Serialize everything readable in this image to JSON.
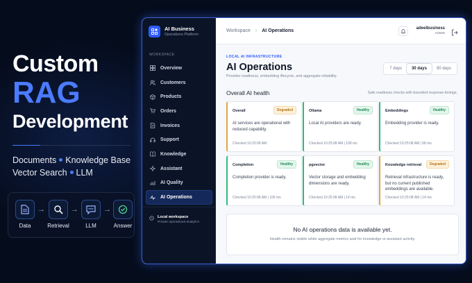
{
  "promo": {
    "line1": "Custom",
    "line2": "RAG",
    "line3": "Development",
    "tags_row1": [
      "Documents",
      "Knowledge Base"
    ],
    "tags_row2": [
      "Vector Search",
      "LLM"
    ],
    "flow": [
      {
        "label": "Data",
        "icon": "document-icon"
      },
      {
        "label": "Retrieval",
        "icon": "search-icon"
      },
      {
        "label": "LLM",
        "icon": "chat-icon"
      },
      {
        "label": "Answer",
        "icon": "check-circle-icon"
      }
    ],
    "accent": "#4b7bff"
  },
  "app": {
    "brand_name": "AI Business",
    "brand_sub": "Operations Platform",
    "workspace_label": "WORKSPACE",
    "nav": [
      {
        "label": "Overview",
        "icon": "grid-icon"
      },
      {
        "label": "Customers",
        "icon": "users-icon"
      },
      {
        "label": "Products",
        "icon": "box-icon"
      },
      {
        "label": "Orders",
        "icon": "cart-icon"
      },
      {
        "label": "Invoices",
        "icon": "invoice-icon"
      },
      {
        "label": "Support",
        "icon": "support-icon"
      },
      {
        "label": "Knowledge",
        "icon": "book-icon"
      },
      {
        "label": "Assistant",
        "icon": "sparkle-icon"
      },
      {
        "label": "AI Quality",
        "icon": "chart-icon"
      },
      {
        "label": "AI Operations",
        "icon": "pulse-icon",
        "active": true
      }
    ],
    "footer_title": "Local workspace",
    "footer_sub": "Private operational analytics"
  },
  "topbar": {
    "crumb_root": "Workspace",
    "crumb_sep": "›",
    "crumb_current": "AI Operations",
    "user_name": "adeelbusiness",
    "user_role": "ADMIN"
  },
  "page": {
    "eyebrow": "LOCAL AI INFRASTRUCTURE",
    "title": "AI Operations",
    "subtitle": "Provider readiness, embedding lifecycle, and aggregate reliability.",
    "ranges": [
      "7 days",
      "30 days",
      "90 days"
    ],
    "selected_range": "30 days",
    "section_title": "Overall AI health",
    "section_note": "Safe readiness checks with bounded response timings."
  },
  "cards": [
    {
      "title": "Overall",
      "status": "Degraded",
      "kind": "warn",
      "desc": "AI services are operational with reduced capability.",
      "checked": "Checked 10:25:08 AM"
    },
    {
      "title": "Ollama",
      "status": "Healthy",
      "kind": "ok",
      "desc": "Local AI providers are ready.",
      "checked": "Checked 10:25:08 AM | 108 ms"
    },
    {
      "title": "Embeddings",
      "status": "Healthy",
      "kind": "ok",
      "desc": "Embedding provider is ready.",
      "checked": "Checked 10:25:08 AM | 68 ms"
    },
    {
      "title": "Completion",
      "status": "Healthy",
      "kind": "ok",
      "desc": "Completion provider is ready.",
      "checked": "Checked 10:25:08 AM | 106 ms"
    },
    {
      "title": "pgvector",
      "status": "Healthy",
      "kind": "ok",
      "desc": "Vector storage and embedding dimensions are ready.",
      "checked": "Checked 10:25:08 AM | 14 ms"
    },
    {
      "title": "Knowledge retrieval",
      "status": "Degraded",
      "kind": "warn",
      "desc": "Retrieval infrastructure is ready, but no current published embeddings are available.",
      "checked": "Checked 10:25:08 AM | 14 ms"
    }
  ],
  "empty": {
    "title": "No AI operations data is available yet.",
    "sub": "Health remains visible while aggregate metrics wait for knowledge or assistant activity."
  },
  "colors": {
    "healthy": "#30b97a",
    "degraded": "#e0a642",
    "primary": "#2f5bff"
  }
}
